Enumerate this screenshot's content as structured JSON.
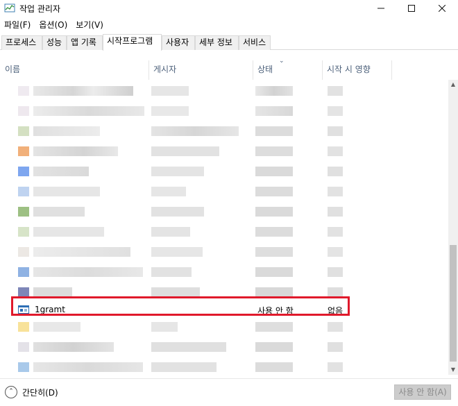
{
  "window": {
    "title": "작업 관리자"
  },
  "menu": [
    "파일(F)",
    "옵션(O)",
    "보기(V)"
  ],
  "tabs": [
    "프로세스",
    "성능",
    "앱 기록",
    "시작프로그램",
    "사용자",
    "세부 정보",
    "서비스"
  ],
  "active_tab": "시작프로그램",
  "columns": {
    "name": "이름",
    "publisher": "게시자",
    "status": "상태",
    "impact": "시작 시 영향"
  },
  "highlighted_row": {
    "name": "1gramt",
    "publisher": "",
    "status": "사용 안 함",
    "impact": "없음"
  },
  "footer": {
    "collapse_label": "간단히(D)",
    "disable_button": "사용 안 함(A)"
  },
  "colors": {
    "highlight_border": "#e0192b",
    "header_text": "#4c607a"
  }
}
